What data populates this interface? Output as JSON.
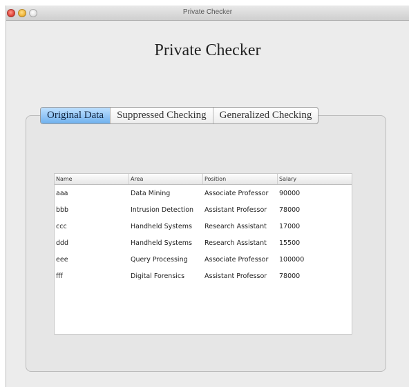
{
  "window": {
    "title": "Private Checker"
  },
  "app": {
    "heading": "Private Checker"
  },
  "tabs": [
    {
      "label": "Original Data",
      "active": true
    },
    {
      "label": "Suppressed Checking",
      "active": false
    },
    {
      "label": "Generalized Checking",
      "active": false
    }
  ],
  "table": {
    "columns": [
      "Name",
      "Area",
      "Position",
      "Salary"
    ],
    "rows": [
      [
        "aaa",
        "Data Mining",
        "Associate Professor",
        "90000"
      ],
      [
        "bbb",
        "Intrusion Detection",
        "Assistant Professor",
        "78000"
      ],
      [
        "ccc",
        "Handheld Systems",
        "Research Assistant",
        "17000"
      ],
      [
        "ddd",
        "Handheld Systems",
        "Research Assistant",
        "15500"
      ],
      [
        "eee",
        "Query Processing",
        "Associate Professor",
        "100000"
      ],
      [
        "fff",
        "Digital Forensics",
        "Assistant Professor",
        "78000"
      ]
    ]
  },
  "colors": {
    "active_tab": "#6fb1ee",
    "window_bg": "#ececec"
  }
}
